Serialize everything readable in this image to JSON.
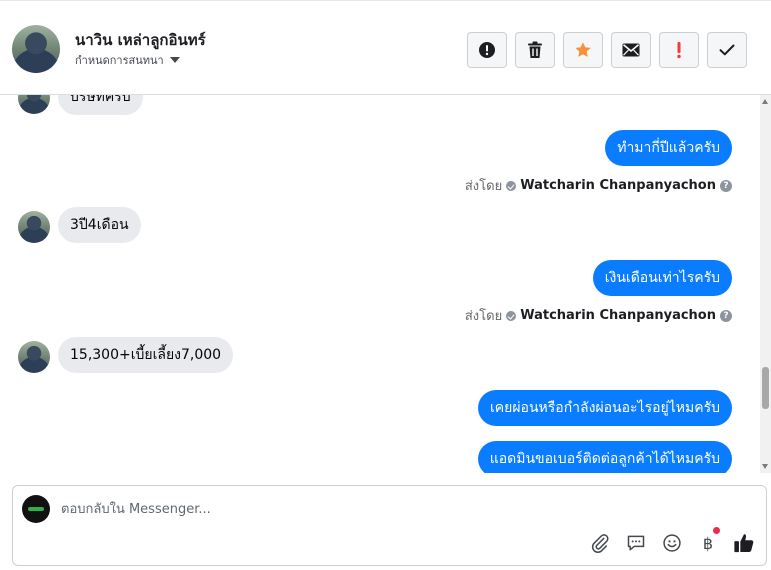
{
  "header": {
    "contact_name": "นาวิน เหล่าลูกอินทร์",
    "conversation_menu_label": "กำหนดการสนทนา",
    "actions": [
      {
        "name": "report-spam",
        "icon": "alert-circle-icon"
      },
      {
        "name": "delete",
        "icon": "trash-icon"
      },
      {
        "name": "star",
        "icon": "star-icon"
      },
      {
        "name": "mark-unread",
        "icon": "envelope-icon"
      },
      {
        "name": "follow-up",
        "icon": "exclamation-icon"
      },
      {
        "name": "mark-done",
        "icon": "check-icon"
      }
    ]
  },
  "messages": [
    {
      "direction": "in",
      "text": "บริษัทครับ"
    },
    {
      "direction": "out",
      "text": "ทำมากี่ปีแล้วครับ",
      "sent_by_label": "ส่งโดย",
      "sender": "Watcharin Chanpanyachon"
    },
    {
      "direction": "in",
      "text": "3ปี4เดือน"
    },
    {
      "direction": "out",
      "text": "เงินเดือนเท่าไรครับ",
      "sent_by_label": "ส่งโดย",
      "sender": "Watcharin Chanpanyachon"
    },
    {
      "direction": "in",
      "text": "15,300+เบี้ยเลี้ยง7,000"
    },
    {
      "direction": "out",
      "text": "เคยผ่อนหรือกำลังผ่อนอะไรอยู่ไหมครับ"
    },
    {
      "direction": "out",
      "text": "แอดมินขอเบอร์ติดต่อลูกค้าได้ไหมครับ"
    }
  ],
  "composer": {
    "placeholder": "ตอบกลับใน Messenger...",
    "tools": [
      "paperclip-icon",
      "quick-reply-icon",
      "emoji-icon",
      "baht-payment-icon",
      "thumbs-up-icon"
    ],
    "baht_symbol": "฿"
  },
  "colors": {
    "outgoing_bubble": "#0a7cff",
    "incoming_bubble": "#e9eaed",
    "star": "#f7923b",
    "follow_up": "#fa383e",
    "notification_dot": "#f02849"
  }
}
